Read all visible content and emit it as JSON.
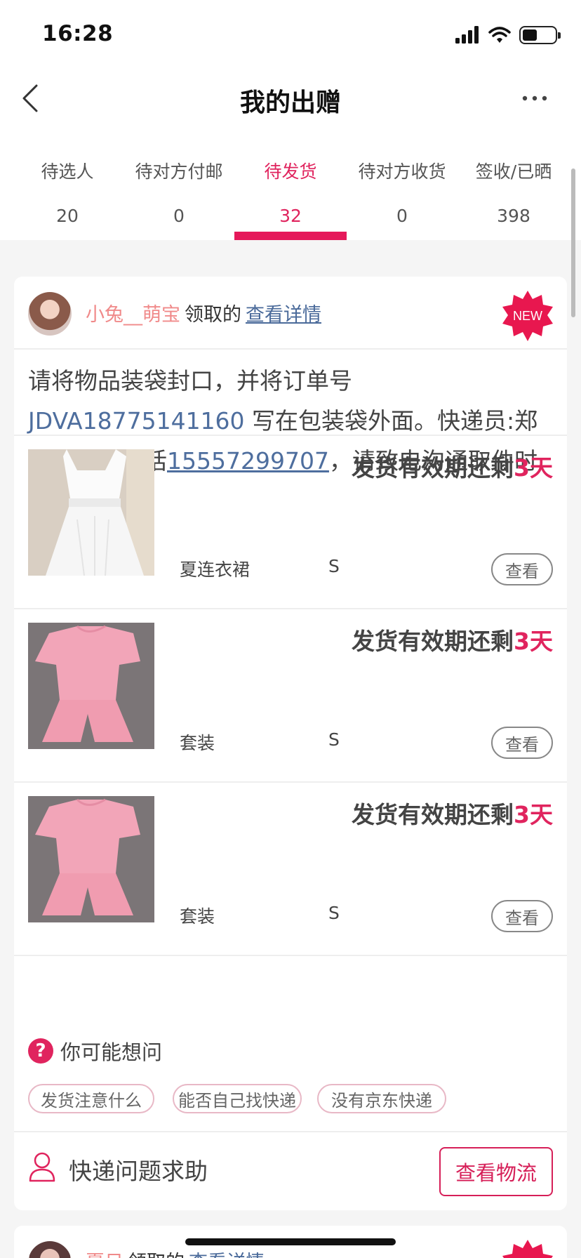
{
  "status_bar": {
    "time": "16:28",
    "battery_level": 0.45
  },
  "nav": {
    "title": "我的出赠",
    "back_icon": "chevron-left-icon",
    "more_icon": "more-dots-icon"
  },
  "tabs": [
    {
      "label": "待选人",
      "count": "20"
    },
    {
      "label": "待对方付邮",
      "count": "0"
    },
    {
      "label": "待发货",
      "count": "32",
      "active": true
    },
    {
      "label": "待对方收货",
      "count": "0"
    },
    {
      "label": "签收/已晒",
      "count": "398"
    }
  ],
  "order_card": {
    "claimer": "小兔__萌宝",
    "claim_text": "领取的",
    "detail_link": "查看详情",
    "badge": "NEW",
    "instructions": {
      "part1": "请将物品装袋封口，并将订单号 ",
      "order_no": "JDVA18775141160",
      "part2": " 写在包装袋外面。快递员:郑慧，联系电话",
      "phone": "15557299707",
      "part3": "，请致电沟通取件时间。"
    },
    "items": [
      {
        "deadline_prefix": "发货有效期还剩",
        "deadline_days": "3天",
        "name": "夏连衣裙",
        "size": "S",
        "view_label": "查看",
        "image": "white-dress"
      },
      {
        "deadline_prefix": "发货有效期还剩",
        "deadline_days": "3天",
        "name": "套装",
        "size": "S",
        "view_label": "查看",
        "image": "pink-set"
      },
      {
        "deadline_prefix": "发货有效期还剩",
        "deadline_days": "3天",
        "name": "套装",
        "size": "S",
        "view_label": "查看",
        "image": "pink-set"
      }
    ],
    "faq": {
      "title": "你可能想问",
      "icon": "question-icon",
      "chips": [
        "发货注意什么",
        "能否自己找快递",
        "没有京东快递"
      ]
    },
    "help": {
      "label": "快递问题求助",
      "icon": "person-icon",
      "button": "查看物流"
    }
  },
  "next_card": {
    "claimer": "夏日",
    "claim_text": "领取的",
    "detail_link": "查看详情"
  },
  "colors": {
    "accent": "#e0245e",
    "link": "#4e6e9e",
    "claimer": "#f08a8a"
  }
}
